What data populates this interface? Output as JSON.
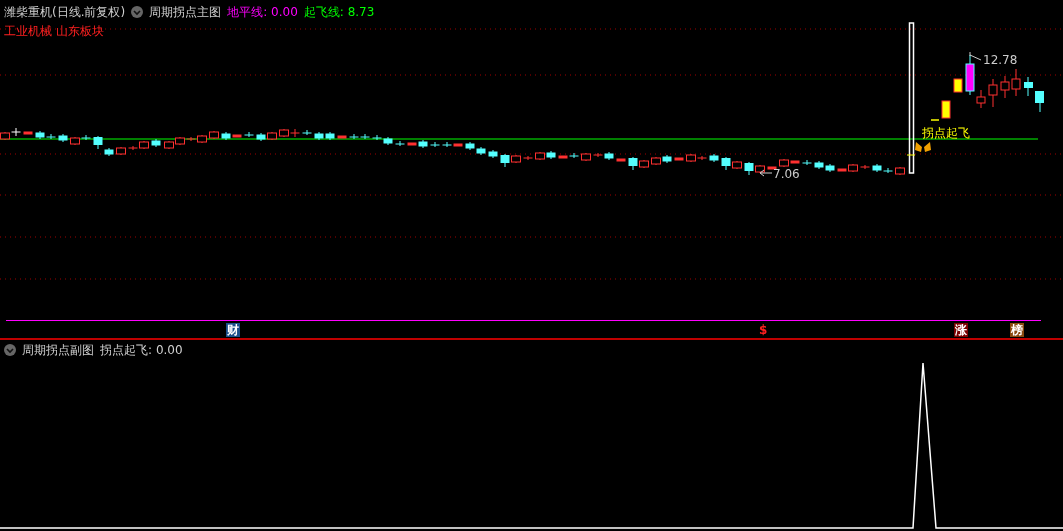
{
  "main_chart": {
    "stock_title": "潍柴重机(日线.前复权)",
    "indicator": "周期拐点主图",
    "legend": [
      {
        "label": "地平线:",
        "value": "0.00",
        "color": "#ff00ff"
      },
      {
        "label": "起飞线:",
        "value": "8.73",
        "color": "#00ff00"
      }
    ],
    "sector": "工业机械 山东板块",
    "high_label": "12.78",
    "low_label": "7.06",
    "signal_label": "拐点起飞"
  },
  "markers": [
    {
      "text": "财",
      "kind": "badge",
      "color": "#1a4f8a"
    },
    {
      "text": "$",
      "kind": "glyph",
      "color": "#ff2020"
    },
    {
      "text": "涨",
      "kind": "badge",
      "color": "#7a0000"
    },
    {
      "text": "榜",
      "kind": "badge",
      "color": "#8a4a10"
    }
  ],
  "sub_chart": {
    "indicator": "周期拐点副图",
    "legend_label": "拐点起飞:",
    "legend_value": "0.00"
  }
}
